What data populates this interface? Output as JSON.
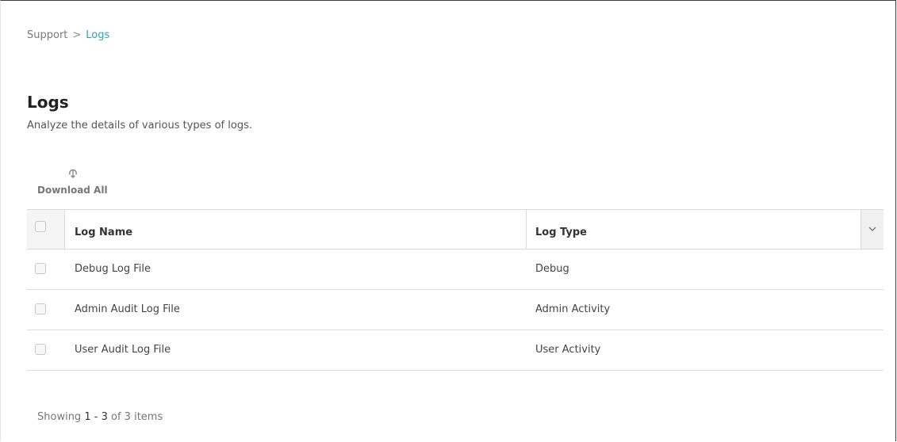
{
  "breadcrumb": {
    "parent": "Support",
    "separator": ">",
    "current": "Logs"
  },
  "page": {
    "title": "Logs",
    "subtitle": "Analyze the details of various types of logs."
  },
  "toolbar": {
    "download_all_label": "Download All",
    "download_icon": "download-icon"
  },
  "grid": {
    "columns": [
      {
        "label": "Log Name"
      },
      {
        "label": "Log Type"
      }
    ],
    "column_menu_icon": "chevron-down-icon",
    "rows": [
      {
        "name": "Debug Log File",
        "type": "Debug"
      },
      {
        "name": "Admin Audit Log File",
        "type": "Admin Activity"
      },
      {
        "name": "User Audit Log File",
        "type": "User Activity"
      }
    ]
  },
  "footer": {
    "prefix": "Showing",
    "range_start": "1",
    "range_dash": "-",
    "range_end": "3",
    "of_text": "of 3 items"
  },
  "colors": {
    "accent": "#2aa6ad",
    "header_bg": "#f5f5f5",
    "border": "#d9d9d9",
    "text": "#333333"
  }
}
